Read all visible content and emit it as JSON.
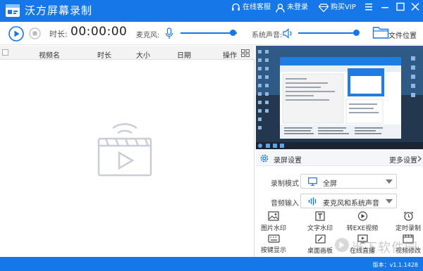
{
  "app": {
    "title": "沃方屏幕录制"
  },
  "topbar": {
    "service": "在线客服",
    "login": "未登录",
    "vip": "购买VIP"
  },
  "controls": {
    "duration_label": "时长:",
    "duration_value": "00:00:00",
    "mic_label": "麦克风:",
    "system_label": "系统声音:",
    "file_location": "文件位置",
    "mic_level": 0.92,
    "system_level": 0.95
  },
  "list": {
    "columns": [
      "视频名",
      "时长",
      "大小",
      "日期",
      "操作"
    ]
  },
  "settings": {
    "title": "录屏设置",
    "more": "更多设置",
    "mode_label": "录制模式",
    "mode_value": "全屏",
    "audio_label": "音频输入",
    "audio_value": "麦克风和系统声音"
  },
  "tools": [
    {
      "label": "图片水印",
      "icon": "image-icon"
    },
    {
      "label": "文字水印",
      "icon": "text-icon"
    },
    {
      "label": "转EXE视频",
      "icon": "convert-icon"
    },
    {
      "label": "定时录制",
      "icon": "alarm-icon"
    },
    {
      "label": "按键显示",
      "icon": "keyboard-icon"
    },
    {
      "label": "桌面画板",
      "icon": "pen-icon"
    },
    {
      "label": "在线直播",
      "icon": "live-icon"
    },
    {
      "label": "视频修改",
      "icon": "video-edit-icon"
    }
  ],
  "watermark": "当下软件园",
  "status": {
    "version": "版本：v1.1.1428"
  },
  "colors": {
    "accent": "#1677e8"
  }
}
